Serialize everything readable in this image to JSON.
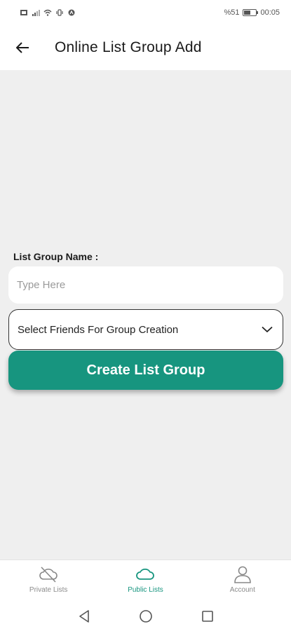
{
  "status_bar": {
    "battery": "%51",
    "time": "00:05"
  },
  "header": {
    "title": "Online List Group Add",
    "back_icon": "arrow-left-icon"
  },
  "form": {
    "name_label": "List Group Name :",
    "name_placeholder": "Type Here",
    "name_value": "",
    "select_text": "Select Friends For Group Creation",
    "select_icon": "chevron-down-icon",
    "create_button_label": "Create List Group"
  },
  "bottom_nav": {
    "items": [
      {
        "label": "Private Lists",
        "icon": "cloud-off-icon",
        "active": false
      },
      {
        "label": "Public Lists",
        "icon": "cloud-icon",
        "active": true
      },
      {
        "label": "Account",
        "icon": "user-icon",
        "active": false
      }
    ]
  },
  "colors": {
    "accent": "#17957f",
    "background": "#efefef",
    "surface": "#ffffff"
  }
}
